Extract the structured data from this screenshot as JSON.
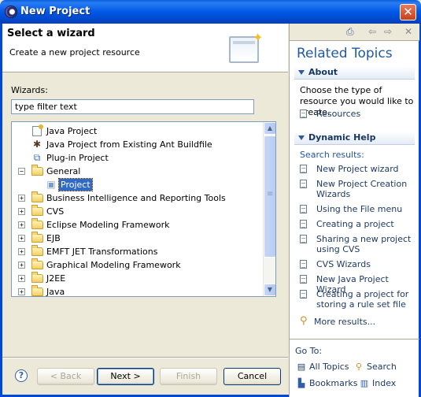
{
  "window": {
    "title": "New Project",
    "close_glyph": "✕",
    "icon": "eclipse-icon"
  },
  "banner": {
    "title": "Select a wizard",
    "description": "Create a new project resource",
    "icon": "new-project-wizard-icon"
  },
  "wizards": {
    "label": "Wizards:",
    "filter_value": "type filter text",
    "tree": [
      {
        "label": "Java Project",
        "expanded": null,
        "selected": false,
        "icon": "java-project-icon"
      },
      {
        "label": "Java Project from Existing Ant Buildfile",
        "expanded": null,
        "selected": false,
        "icon": "ant-icon"
      },
      {
        "label": "Plug-in Project",
        "expanded": null,
        "selected": false,
        "icon": "plugin-project-icon"
      },
      {
        "label": "General",
        "expanded": true,
        "selected": false,
        "icon": "folder-open-icon"
      },
      {
        "label": "Project",
        "expanded": null,
        "selected": true,
        "icon": "project-icon"
      },
      {
        "label": "Business Intelligence and Reporting Tools",
        "expanded": false,
        "selected": false,
        "icon": "folder-icon"
      },
      {
        "label": "CVS",
        "expanded": false,
        "selected": false,
        "icon": "folder-icon"
      },
      {
        "label": "Eclipse Modeling Framework",
        "expanded": false,
        "selected": false,
        "icon": "folder-icon"
      },
      {
        "label": "EJB",
        "expanded": false,
        "selected": false,
        "icon": "folder-icon"
      },
      {
        "label": "EMFT JET Transformations",
        "expanded": false,
        "selected": false,
        "icon": "folder-icon"
      },
      {
        "label": "Graphical Modeling Framework",
        "expanded": false,
        "selected": false,
        "icon": "folder-icon"
      },
      {
        "label": "J2EE",
        "expanded": false,
        "selected": false,
        "icon": "folder-icon"
      },
      {
        "label": "Java",
        "expanded": false,
        "selected": false,
        "icon": "folder-icon"
      }
    ]
  },
  "buttons": {
    "help": "?",
    "back": "< Back",
    "next": "Next >",
    "finish": "Finish",
    "cancel": "Cancel"
  },
  "help_pane": {
    "title": "Related Topics",
    "about": {
      "header": "About",
      "description": "Choose the type of resource you would like to create.",
      "links": [
        "Resources"
      ]
    },
    "dynamic": {
      "header": "Dynamic Help",
      "search_results_label": "Search results:",
      "links": [
        "New Project wizard",
        "New Project Creation Wizards",
        "Using the File menu",
        "Creating a project",
        "Sharing a new project using CVS",
        "CVS Wizards",
        "New Java Project Wizard",
        "Creating a project for storing a rule set file"
      ],
      "more": "More results..."
    },
    "goto": {
      "label": "Go To:",
      "all_topics": "All Topics",
      "search": "Search",
      "bookmarks": "Bookmarks",
      "index": "Index"
    }
  },
  "colors": {
    "title_bar": "#0058e6",
    "selection": "#316ac5",
    "help_title": "#1f5aa8"
  }
}
